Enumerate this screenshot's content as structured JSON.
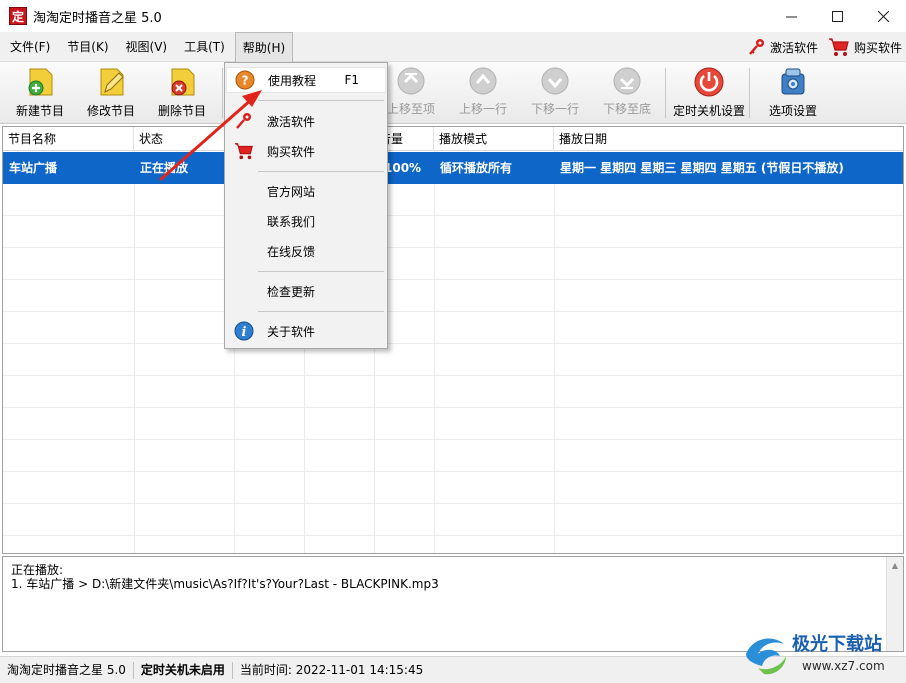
{
  "window": {
    "title": "淘淘定时播音之星 5.0",
    "app_icon_char": "定",
    "controls": [
      "minimize-icon",
      "maximize-icon",
      "close-icon"
    ]
  },
  "menubar": {
    "items": [
      "文件(F)",
      "节目(K)",
      "视图(V)",
      "工具(T)",
      "帮助(H)"
    ],
    "right": {
      "activate_label": "激活软件",
      "buy_label": "购买软件"
    }
  },
  "toolbar": {
    "buttons": [
      {
        "label": "新建节目",
        "icon": "add-program-icon",
        "color": "#e8c22a"
      },
      {
        "label": "修改节目",
        "icon": "edit-program-icon",
        "color": "#e8c22a"
      },
      {
        "label": "删除节目",
        "icon": "delete-program-icon",
        "color": "#e8c22a"
      },
      {
        "label": "上移至项",
        "icon": "move-top-icon",
        "color": "#bdbdbd"
      },
      {
        "label": "上移一行",
        "icon": "move-up-icon",
        "color": "#bdbdbd"
      },
      {
        "label": "下移一行",
        "icon": "move-down-icon",
        "color": "#bdbdbd"
      },
      {
        "label": "下移至底",
        "icon": "move-bottom-icon",
        "color": "#bdbdbd"
      },
      {
        "label": "定时关机设置",
        "icon": "power-icon",
        "color": "#e24b3c"
      },
      {
        "label": "选项设置",
        "icon": "options-icon",
        "color": "#3e7cc0"
      }
    ]
  },
  "table": {
    "headers": [
      "节目名称",
      "状态",
      "",
      "",
      "音量",
      "播放模式",
      "播放日期"
    ],
    "rows": [
      [
        "车站广播",
        "正在播放",
        "",
        "",
        "100%",
        "循环播放所有",
        "星期一 星期四 星期三 星期四 星期五 (节假日不播放)"
      ]
    ]
  },
  "help_menu": {
    "items": [
      {
        "label": "使用教程",
        "shortcut": "F1",
        "icon": "help-question-icon"
      },
      {
        "label": "激活软件",
        "icon": "key-icon"
      },
      {
        "label": "购买软件",
        "icon": "cart-icon"
      },
      {
        "label": "官方网站"
      },
      {
        "label": "联系我们"
      },
      {
        "label": "在线反馈"
      },
      {
        "label": "检查更新"
      },
      {
        "label": "关于软件",
        "icon": "info-icon"
      }
    ]
  },
  "now_playing": {
    "title": "正在播放:",
    "line": "1. 车站广播 > D:\\新建文件夹\\music\\As?If?It's?Your?Last - BLACKPINK.mp3"
  },
  "statusbar": {
    "app": "淘淘定时播音之星 5.0",
    "shutdown": "定时关机未启用",
    "time": "当前时间:   2022-11-01 14:15:45"
  },
  "watermark": {
    "text": "极光下载站",
    "url": "www.xz7.com"
  },
  "colors": {
    "selection": "#0f66c9",
    "arrow": "#e2231a"
  }
}
